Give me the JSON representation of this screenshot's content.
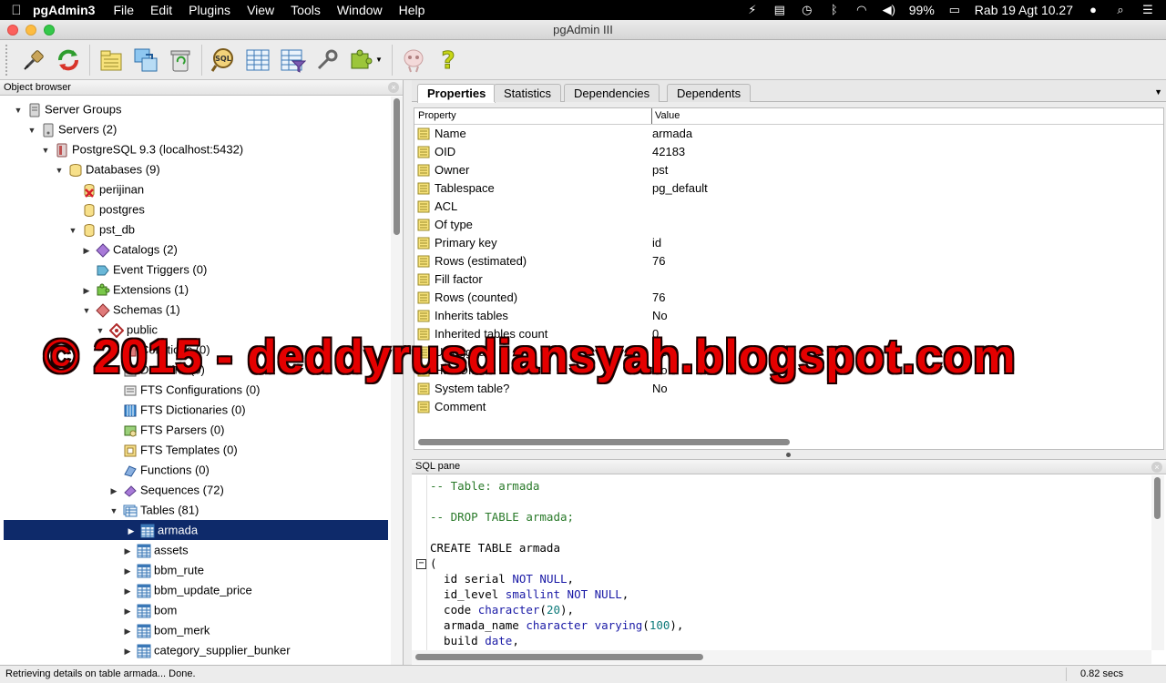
{
  "menubar": {
    "app_name": "pgAdmin3",
    "items": [
      "File",
      "Edit",
      "Plugins",
      "View",
      "Tools",
      "Window",
      "Help"
    ],
    "battery": "99%",
    "clock": "Rab 19 Agt  10.27"
  },
  "window": {
    "title": "pgAdmin III"
  },
  "object_browser": {
    "title": "Object browser",
    "tree": [
      {
        "label": "Server Groups",
        "toggle": "▼",
        "icon": "server-group-icon"
      },
      {
        "label": "Servers (2)",
        "toggle": "▼",
        "icon": "servers-icon"
      },
      {
        "label": "PostgreSQL 9.3 (localhost:5432)",
        "toggle": "▼",
        "icon": "server-icon"
      },
      {
        "label": "Databases (9)",
        "toggle": "▼",
        "icon": "databases-icon"
      },
      {
        "label": "perijinan",
        "toggle": "",
        "icon": "database-disconnected-icon"
      },
      {
        "label": "postgres",
        "toggle": "",
        "icon": "database-icon"
      },
      {
        "label": "pst_db",
        "toggle": "▼",
        "icon": "database-icon"
      },
      {
        "label": "Catalogs (2)",
        "toggle": "▶",
        "icon": "catalogs-icon"
      },
      {
        "label": "Event Triggers (0)",
        "toggle": "",
        "icon": "event-trigger-icon"
      },
      {
        "label": "Extensions (1)",
        "toggle": "▶",
        "icon": "extensions-icon"
      },
      {
        "label": "Schemas (1)",
        "toggle": "▼",
        "icon": "schemas-icon"
      },
      {
        "label": "public",
        "toggle": "▼",
        "icon": "schema-icon"
      },
      {
        "label": "Collations (0)",
        "toggle": "",
        "icon": "collations-icon"
      },
      {
        "label": "Domains (0)",
        "toggle": "",
        "icon": "domains-icon"
      },
      {
        "label": "FTS Configurations (0)",
        "toggle": "",
        "icon": "fts-configuration-icon"
      },
      {
        "label": "FTS Dictionaries (0)",
        "toggle": "",
        "icon": "fts-dictionary-icon"
      },
      {
        "label": "FTS Parsers (0)",
        "toggle": "",
        "icon": "fts-parser-icon"
      },
      {
        "label": "FTS Templates (0)",
        "toggle": "",
        "icon": "fts-template-icon"
      },
      {
        "label": "Functions (0)",
        "toggle": "",
        "icon": "functions-icon"
      },
      {
        "label": "Sequences (72)",
        "toggle": "▶",
        "icon": "sequences-icon"
      },
      {
        "label": "Tables (81)",
        "toggle": "▼",
        "icon": "tables-icon"
      },
      {
        "label": "armada",
        "toggle": "▶",
        "icon": "table-icon",
        "selected": true
      },
      {
        "label": "assets",
        "toggle": "▶",
        "icon": "table-icon"
      },
      {
        "label": "bbm_rute",
        "toggle": "▶",
        "icon": "table-icon"
      },
      {
        "label": "bbm_update_price",
        "toggle": "▶",
        "icon": "table-icon"
      },
      {
        "label": "bom",
        "toggle": "▶",
        "icon": "table-icon"
      },
      {
        "label": "bom_merk",
        "toggle": "▶",
        "icon": "table-icon"
      },
      {
        "label": "category_supplier_bunker",
        "toggle": "▶",
        "icon": "table-icon"
      }
    ]
  },
  "tabs": [
    "Properties",
    "Statistics",
    "Dependencies",
    "Dependents"
  ],
  "properties": {
    "header_property": "Property",
    "header_value": "Value",
    "rows": [
      {
        "name": "Name",
        "value": "armada"
      },
      {
        "name": "OID",
        "value": "42183"
      },
      {
        "name": "Owner",
        "value": "pst"
      },
      {
        "name": "Tablespace",
        "value": "pg_default"
      },
      {
        "name": "ACL",
        "value": ""
      },
      {
        "name": "Of type",
        "value": ""
      },
      {
        "name": "Primary key",
        "value": "id"
      },
      {
        "name": "Rows (estimated)",
        "value": "76"
      },
      {
        "name": "Fill factor",
        "value": ""
      },
      {
        "name": "Rows (counted)",
        "value": "76"
      },
      {
        "name": "Inherits tables",
        "value": "No"
      },
      {
        "name": "Inherited tables count",
        "value": "0"
      },
      {
        "name": "Unlogged?",
        "value": "No"
      },
      {
        "name": "Has OIDs?",
        "value": "No"
      },
      {
        "name": "System table?",
        "value": "No"
      },
      {
        "name": "Comment",
        "value": ""
      }
    ]
  },
  "sql_pane": {
    "title": "SQL pane",
    "lines": [
      [
        {
          "t": "-- Table: armada",
          "c": "comment"
        }
      ],
      [],
      [
        {
          "t": "-- DROP TABLE armada;",
          "c": "comment"
        }
      ],
      [],
      [
        {
          "t": "CREATE TABLE armada",
          "c": ""
        }
      ],
      [
        {
          "t": "(",
          "c": ""
        }
      ],
      [
        {
          "t": "  id serial ",
          "c": ""
        },
        {
          "t": "NOT NULL",
          "c": "kw"
        },
        {
          "t": ",",
          "c": ""
        }
      ],
      [
        {
          "t": "  id_level ",
          "c": ""
        },
        {
          "t": "smallint",
          "c": "kw"
        },
        {
          "t": " ",
          "c": ""
        },
        {
          "t": "NOT NULL",
          "c": "kw"
        },
        {
          "t": ",",
          "c": ""
        }
      ],
      [
        {
          "t": "  code ",
          "c": ""
        },
        {
          "t": "character",
          "c": "kw"
        },
        {
          "t": "(",
          "c": ""
        },
        {
          "t": "20",
          "c": "num"
        },
        {
          "t": "),",
          "c": ""
        }
      ],
      [
        {
          "t": "  armada_name ",
          "c": ""
        },
        {
          "t": "character varying",
          "c": "kw"
        },
        {
          "t": "(",
          "c": ""
        },
        {
          "t": "100",
          "c": "num"
        },
        {
          "t": "),",
          "c": ""
        }
      ],
      [
        {
          "t": "  build ",
          "c": ""
        },
        {
          "t": "date",
          "c": "kw"
        },
        {
          "t": ",",
          "c": ""
        }
      ]
    ]
  },
  "watermark": "© 2015 - deddyrusdiansyah.blogspot.com",
  "status": {
    "text": "Retrieving details on table armada... Done.",
    "time": "0.82 secs"
  },
  "colors": {
    "selection": "#0e2a6a",
    "watermark": "#e40000",
    "sql_comment": "#2a7a2a",
    "sql_keyword": "#1a1aa6"
  }
}
